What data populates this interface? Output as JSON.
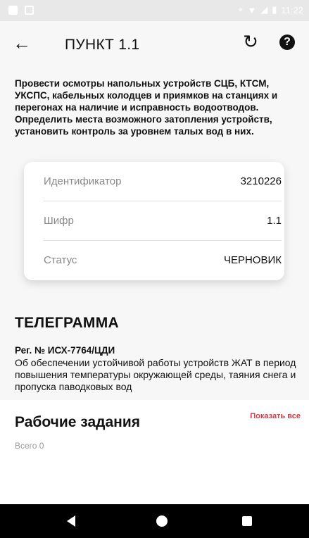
{
  "status_bar": {
    "time": "11:22",
    "icons": [
      "sim-icon",
      "image-icon",
      "location-icon",
      "wifi-icon",
      "signal-icon",
      "battery-icon"
    ]
  },
  "app_bar": {
    "title": "ПУНКТ 1.1",
    "back_icon": "arrow-left-icon",
    "refresh_icon": "refresh-icon",
    "help_icon": "help-icon"
  },
  "description": "Провести осмотры напольных устройств СЦБ, КТСМ, УКСПС, кабельных колодцев и приямков на станциях и перегонах на наличие и исправность водоотводов. Определить места возможного затопления устройств, установить контроль за уровнем талых вод в них.",
  "details": [
    {
      "label": "Идентификатор",
      "value": "3210226"
    },
    {
      "label": "Шифр",
      "value": "1.1"
    },
    {
      "label": "Статус",
      "value": "ЧЕРНОВИК"
    }
  ],
  "telegram": {
    "heading": "ТЕЛЕГРАММА",
    "reg": "Рег. № ИСХ-7764/ЦДИ",
    "text": "Об обеспечении устойчивой работы устройств ЖАТ в период повышения температуры окружающей среды, таяния снега и пропуска паводковых вод"
  },
  "tasks": {
    "title": "Рабочие задания",
    "show_all": "Показать все",
    "total": "Всего 0"
  },
  "colors": {
    "accent": "#d33b45",
    "background": "#f7f7f7",
    "nav_bar": "#000000"
  }
}
